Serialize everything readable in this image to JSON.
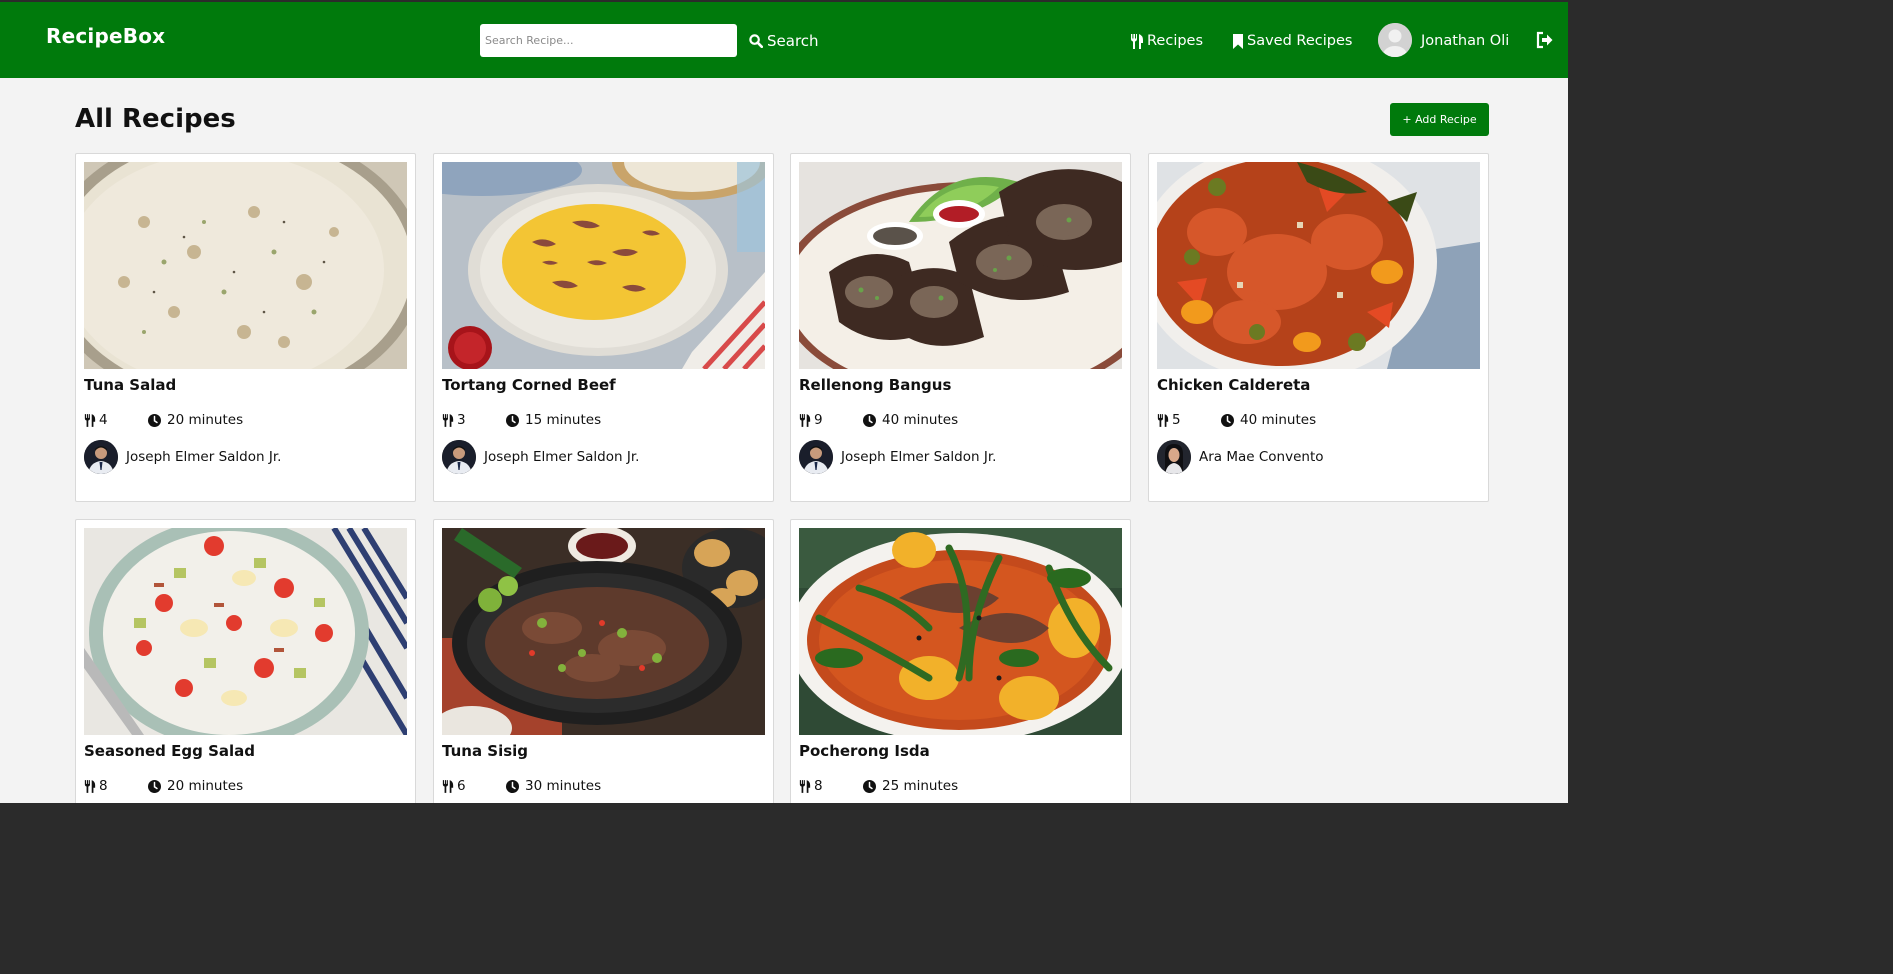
{
  "navbar": {
    "brand": "RecipeBox",
    "search_placeholder": "Search Recipe...",
    "search_label": "Search",
    "recipes_label": "Recipes",
    "saved_label": "Saved Recipes",
    "user_name": "Jonathan Oli"
  },
  "main": {
    "title": "All Recipes",
    "add_label": "+ Add Recipe"
  },
  "colors": {
    "brand_green": "#007a0c",
    "background": "#f3f3f3"
  },
  "recipes": [
    {
      "title": "Tuna Salad",
      "servings": "4",
      "time": "20 minutes",
      "author": "Joseph Elmer Saldon Jr."
    },
    {
      "title": "Tortang Corned Beef",
      "servings": "3",
      "time": "15 minutes",
      "author": "Joseph Elmer Saldon Jr."
    },
    {
      "title": "Rellenong Bangus",
      "servings": "9",
      "time": "40 minutes",
      "author": "Joseph Elmer Saldon Jr."
    },
    {
      "title": "Chicken Caldereta",
      "servings": "5",
      "time": "40 minutes",
      "author": "Ara Mae Convento"
    },
    {
      "title": "Seasoned Egg Salad",
      "servings": "8",
      "time": "20 minutes",
      "author": ""
    },
    {
      "title": "Tuna Sisig",
      "servings": "6",
      "time": "30 minutes",
      "author": ""
    },
    {
      "title": "Pocherong Isda",
      "servings": "8",
      "time": "25 minutes",
      "author": ""
    }
  ]
}
